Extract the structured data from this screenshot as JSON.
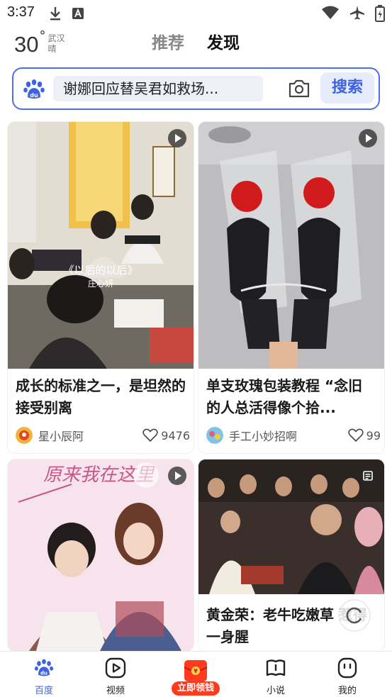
{
  "status": {
    "time": "3:37"
  },
  "weather": {
    "temp": "30",
    "deg": "°",
    "city": "武汉",
    "condition": "晴"
  },
  "tabs": [
    {
      "label": "推荐"
    },
    {
      "label": "发现",
      "active": true
    }
  ],
  "search": {
    "query": "谢娜回应替吴君如救场...",
    "button": "搜索"
  },
  "cards": [
    {
      "title": "成长的标准之一，是坦然的接受别离",
      "author": "星小辰阿",
      "likes": "9476",
      "overlay_line1": "《以后的以后》",
      "overlay_line2": "庄心妍"
    },
    {
      "title": "单支玫瑰包装教程 “念旧的人总活得像个拾...",
      "author": "手工小妙招啊",
      "likes": "99"
    },
    {
      "title": "",
      "author": "",
      "likes": "",
      "overlay_top": "原来我在这里"
    },
    {
      "title": "黄金荣：老牛吃嫩草 惹得一身腥",
      "author": "",
      "likes": ""
    }
  ],
  "nav": [
    {
      "label": "百度",
      "icon": "baidu-paw-icon",
      "active": true
    },
    {
      "label": "视频",
      "icon": "video-play-icon"
    },
    {
      "label": "立即领钱",
      "icon": "red-envelope-icon"
    },
    {
      "label": "小说",
      "icon": "book-icon"
    },
    {
      "label": "我的",
      "icon": "profile-face-icon"
    }
  ],
  "colors": {
    "accent": "#4e6ef2",
    "search_button_text": "#3d62e4",
    "promo": "#ff3b1f"
  }
}
